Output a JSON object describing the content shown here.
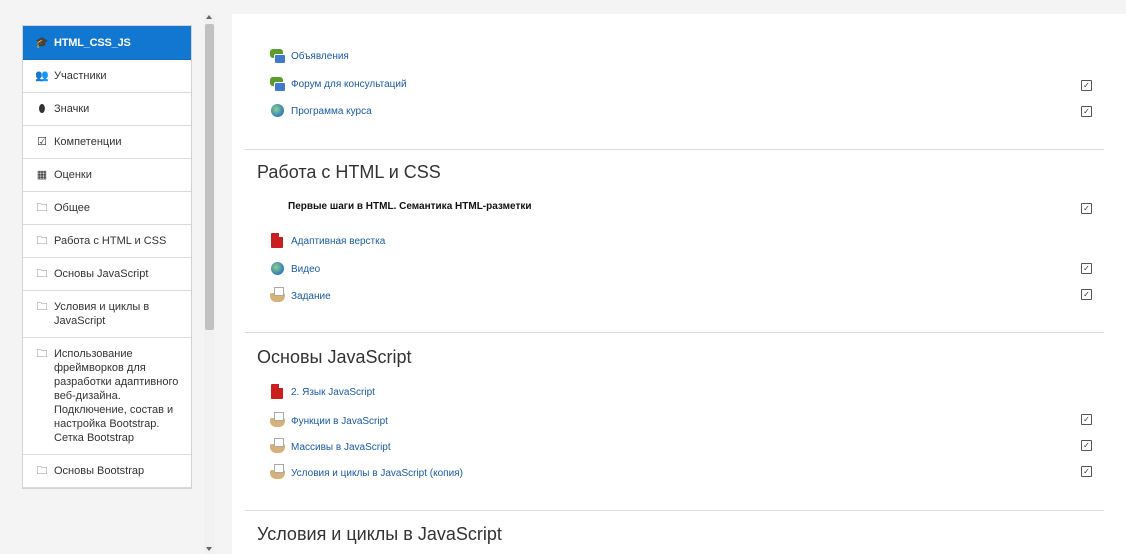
{
  "sidebar": {
    "items": [
      {
        "icon": "graduation-cap-icon",
        "glyph": "🎓",
        "label": "HTML_CSS_JS",
        "active": true
      },
      {
        "icon": "users-icon",
        "glyph": "👥",
        "label": "Участники"
      },
      {
        "icon": "shield-icon",
        "glyph": "⬮",
        "label": "Значки"
      },
      {
        "icon": "checkbox-icon",
        "glyph": "☑",
        "label": "Компетенции"
      },
      {
        "icon": "table-icon",
        "glyph": "▦",
        "label": "Оценки"
      },
      {
        "icon": "folder-icon",
        "glyph": "🗀",
        "label": "Общее"
      },
      {
        "icon": "folder-icon",
        "glyph": "🗀",
        "label": "Работа с HTML и CSS"
      },
      {
        "icon": "folder-icon",
        "glyph": "🗀",
        "label": "Основы JavaScript"
      },
      {
        "icon": "folder-icon",
        "glyph": "🗀",
        "label": "Условия и циклы в JavaScript"
      },
      {
        "icon": "folder-icon",
        "glyph": "🗀",
        "label": "Использование фреймворков для разработки адаптивного веб-дизайна. Подключение, состав и настройка Bootstrap. Сетка Bootstrap"
      },
      {
        "icon": "folder-icon",
        "glyph": "🗀",
        "label": "Основы Bootstrap"
      }
    ]
  },
  "general": {
    "activities": [
      {
        "type": "forum",
        "label": "Объявления",
        "completion": false
      },
      {
        "type": "forum",
        "label": "Форум для консультаций",
        "completion": true
      },
      {
        "type": "url",
        "label": "Программа курса",
        "completion": true
      }
    ]
  },
  "sections": [
    {
      "title": "Работа с HTML и CSS",
      "label": "Первые шаги в HTML. Семантика HTML-разметки",
      "activities": [
        {
          "type": "pdf",
          "label": "Адаптивная верстка",
          "completion": false
        },
        {
          "type": "url",
          "label": "Видео",
          "completion": true
        },
        {
          "type": "assign",
          "label": "Задание",
          "completion": true
        }
      ]
    },
    {
      "title": "Основы JavaScript",
      "activities": [
        {
          "type": "pdf",
          "label": "2. Язык JavaScript",
          "completion": false
        },
        {
          "type": "assign",
          "label": "Функции в JavaScript",
          "completion": true
        },
        {
          "type": "assign",
          "label": "Массивы в JavaScript",
          "completion": true
        },
        {
          "type": "assign",
          "label": "Условия и циклы в JavaScript (копия)",
          "completion": true
        }
      ]
    },
    {
      "title": "Условия и циклы в JavaScript"
    }
  ],
  "check_glyph": "✓",
  "colors": {
    "accent": "#1177d1",
    "link": "#1a5aa5"
  }
}
